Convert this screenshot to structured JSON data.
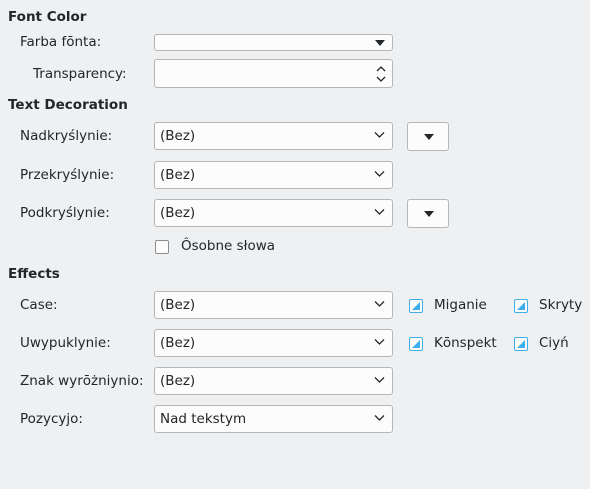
{
  "font_color": {
    "title": "Font Color",
    "farba_label": "Farba fōnta:",
    "transparency_label": "Transparency:",
    "transparency_value": ""
  },
  "text_decoration": {
    "title": "Text Decoration",
    "overline_label": "Nadkryślynie:",
    "overline_value": "(Bez)",
    "strike_label": "Przekryślynie:",
    "strike_value": "(Bez)",
    "underline_label": "Podkryślynie:",
    "underline_value": "(Bez)",
    "individual_words_label": "Ôsobne słowa"
  },
  "effects": {
    "title": "Effects",
    "case_label": "Case:",
    "case_value": "(Bez)",
    "blink_label": "Miganie",
    "hidden_label": "Skryty",
    "relief_label": "Uwypuklynie:",
    "relief_value": "(Bez)",
    "outline_label": "Kōnspekt",
    "shadow_label": "Ciyń",
    "emphasis_label": "Znak wyrōżniynio:",
    "emphasis_value": "(Bez)",
    "position_label": "Pozycyjo:",
    "position_value": "Nad tekstym"
  },
  "colors": {
    "accent": "#3daee9",
    "background": "#eff0f1",
    "field": "#fcfcfc"
  }
}
